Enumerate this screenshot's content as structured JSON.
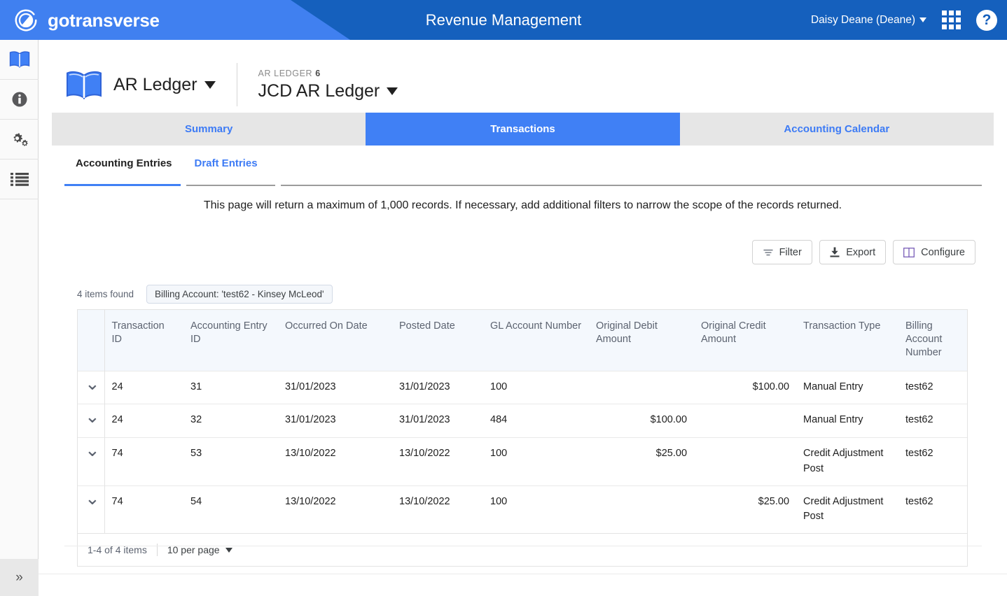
{
  "header": {
    "brand": "gotransverse",
    "app_title": "Revenue Management",
    "user": "Daisy Deane (Deane)",
    "apps_icon": "apps-grid-icon",
    "help_icon": "help-circle-icon",
    "logo_icon": "gotransverse-logo-icon",
    "colors": {
      "dark_blue": "#1560bd",
      "light_blue": "#4080f0"
    }
  },
  "sidebar": {
    "items": [
      {
        "name": "ledger",
        "icon": "open-book-icon",
        "active": true
      },
      {
        "name": "info",
        "icon": "info-circle-icon",
        "active": false
      },
      {
        "name": "settings",
        "icon": "gears-icon",
        "active": false
      },
      {
        "name": "list",
        "icon": "list-icon",
        "active": false
      }
    ],
    "expand_icon": "double-chevron-right-icon"
  },
  "ledger": {
    "icon": "open-book-icon",
    "selector_label": "AR Ledger",
    "kicker_label": "AR LEDGER",
    "kicker_value": "6",
    "name": "JCD AR Ledger"
  },
  "tabs": [
    {
      "label": "Summary",
      "active": false
    },
    {
      "label": "Transactions",
      "active": true
    },
    {
      "label": "Accounting Calendar",
      "active": false
    }
  ],
  "subtabs": [
    {
      "label": "Accounting Entries",
      "active": true
    },
    {
      "label": "Draft Entries",
      "active": false
    }
  ],
  "notice": "This page will return a maximum of 1,000 records. If necessary, add additional filters to narrow the scope of the records returned.",
  "actions": [
    {
      "label": "Filter",
      "icon": "filter-icon"
    },
    {
      "label": "Export",
      "icon": "download-icon"
    },
    {
      "label": "Configure",
      "icon": "columns-icon"
    }
  ],
  "results": {
    "count_label": "4 items found",
    "filter_chip": "Billing Account: 'test62 - Kinsey McLeod'"
  },
  "table": {
    "columns": [
      "Transaction ID",
      "Accounting Entry ID",
      "Occurred On Date",
      "Posted Date",
      "GL Account Number",
      "Original Debit Amount",
      "Original Credit Amount",
      "Transaction Type",
      "Billing Account Number"
    ],
    "expander_icon": "chevron-down-icon",
    "rows": [
      {
        "transaction_id": "24",
        "accounting_entry_id": "31",
        "occurred_on_date": "31/01/2023",
        "posted_date": "31/01/2023",
        "gl_account_number": "100",
        "original_debit_amount": "",
        "original_credit_amount": "$100.00",
        "transaction_type": "Manual Entry",
        "billing_account_number": "test62"
      },
      {
        "transaction_id": "24",
        "accounting_entry_id": "32",
        "occurred_on_date": "31/01/2023",
        "posted_date": "31/01/2023",
        "gl_account_number": "484",
        "original_debit_amount": "$100.00",
        "original_credit_amount": "",
        "transaction_type": "Manual Entry",
        "billing_account_number": "test62"
      },
      {
        "transaction_id": "74",
        "accounting_entry_id": "53",
        "occurred_on_date": "13/10/2022",
        "posted_date": "13/10/2022",
        "gl_account_number": "100",
        "original_debit_amount": "$25.00",
        "original_credit_amount": "",
        "transaction_type": "Credit Adjustment Post",
        "billing_account_number": "test62"
      },
      {
        "transaction_id": "74",
        "accounting_entry_id": "54",
        "occurred_on_date": "13/10/2022",
        "posted_date": "13/10/2022",
        "gl_account_number": "100",
        "original_debit_amount": "",
        "original_credit_amount": "$25.00",
        "transaction_type": "Credit Adjustment Post",
        "billing_account_number": "test62"
      }
    ]
  },
  "pagination": {
    "range_label": "1-4 of 4 items",
    "per_page_label": "10 per page",
    "chevron_icon": "chevron-down-icon"
  }
}
